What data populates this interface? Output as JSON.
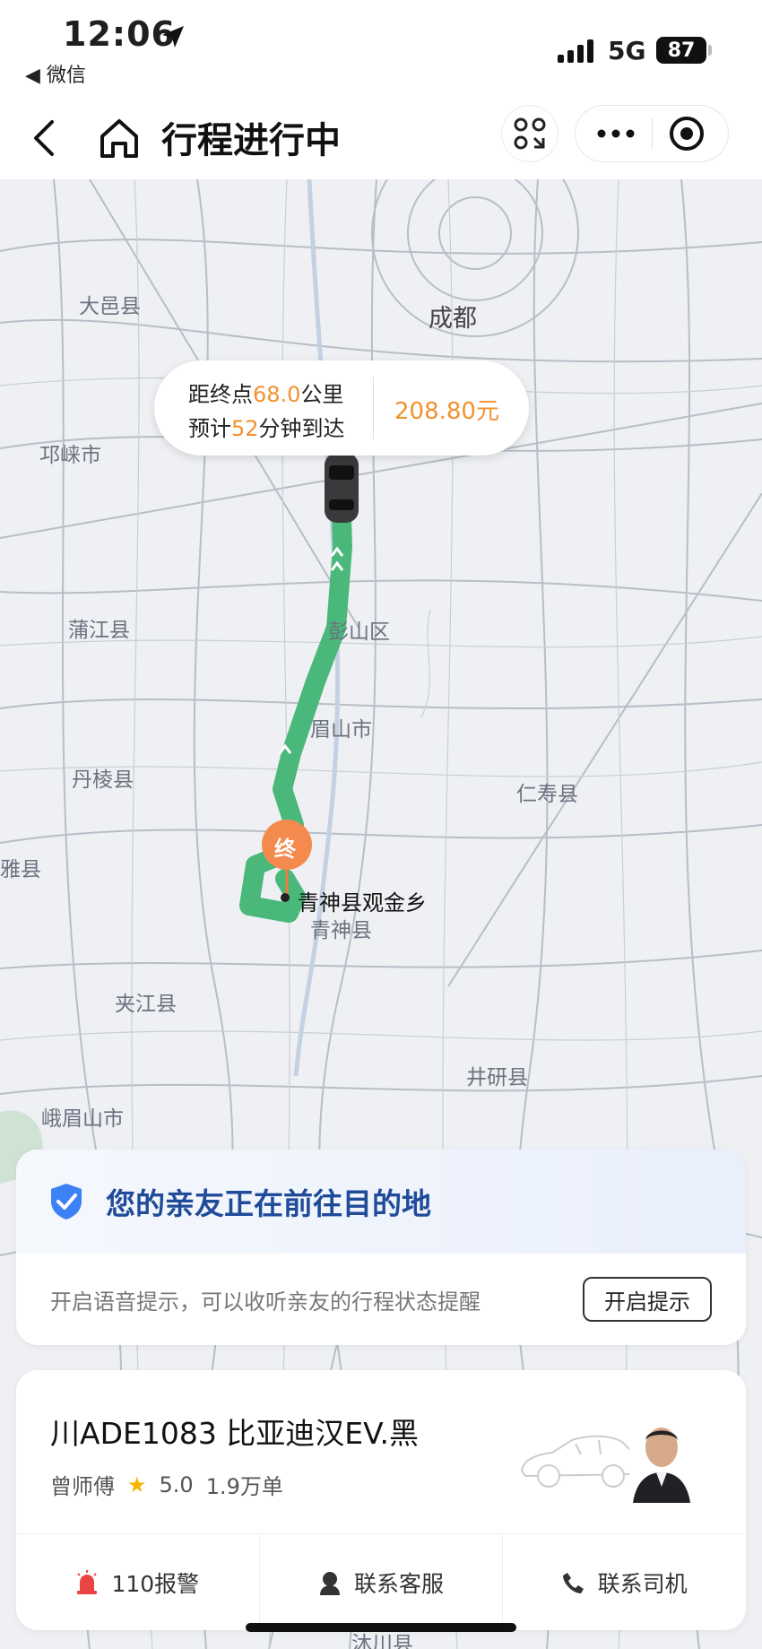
{
  "status_bar": {
    "time": "12:06",
    "back_app": "◀ 微信",
    "network": "5G",
    "battery": "87"
  },
  "nav": {
    "title": "行程进行中"
  },
  "map": {
    "cities": {
      "dayi": "大邑县",
      "chengdu": "成都",
      "qionglai": "邛崃市",
      "pujiang": "蒲江县",
      "pengshan": "彭山区",
      "meishan": "眉山市",
      "danling": "丹棱县",
      "renshou": "仁寿县",
      "ya": "雅县",
      "qingshen": "青神县",
      "jiajiang": "夹江县",
      "jingyan": "井研县",
      "emeishan": "峨眉山市",
      "muchuan": "沐川县"
    },
    "destination": {
      "marker": "终",
      "label": "青神县观金乡"
    }
  },
  "trip_info": {
    "distance_prefix": "距终点",
    "distance_value": "68.0",
    "distance_unit": "公里",
    "eta_prefix": "预计",
    "eta_value": "52",
    "eta_suffix": "分钟到达",
    "price": "208.80元"
  },
  "safety": {
    "title": "您的亲友正在前往目的地",
    "description": "开启语音提示，可以收听亲友的行程状态提醒",
    "button": "开启提示"
  },
  "driver": {
    "plate_and_car": "川ADE1083 比亚迪汉EV.黑",
    "name": "曾师傅",
    "rating": "5.0",
    "orders": "1.9万单",
    "actions": {
      "police": "110报警",
      "service": "联系客服",
      "call_driver": "联系司机"
    }
  },
  "colors": {
    "route": "#4ab87a",
    "accent": "#f2912f",
    "safety_blue": "#1f4b99",
    "shield": "#3c82f6"
  }
}
